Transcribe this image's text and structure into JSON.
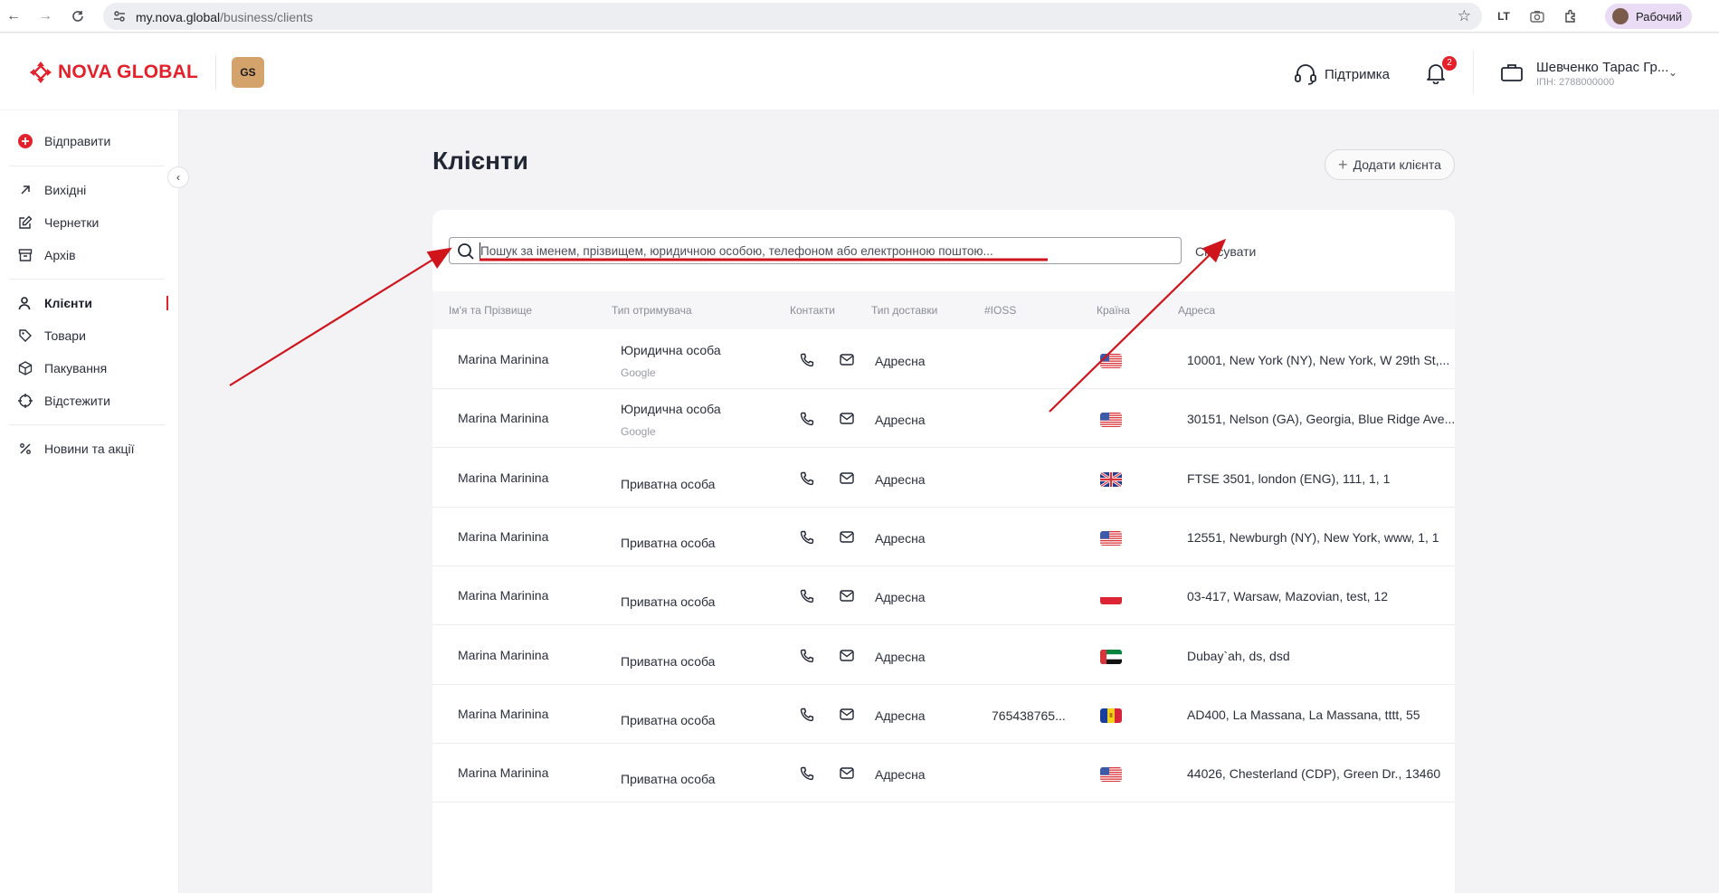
{
  "browser": {
    "url_host": "my.nova.global",
    "url_path": "/business/clients",
    "extension_label": "LT",
    "profile_name": "Рабочий"
  },
  "header": {
    "brand": "NOVA GLOBAL",
    "partner_badge": "GS",
    "support_label": "Підтримка",
    "notifications_count": "2",
    "user_name": "Шевченко Тарас Гр...",
    "user_ipn": "ІПН: 2788000000"
  },
  "sidebar": {
    "send_label": "Відправити",
    "items": [
      {
        "label": "Вихідні"
      },
      {
        "label": "Чернетки"
      },
      {
        "label": "Архів"
      },
      {
        "label": "Клієнти"
      },
      {
        "label": "Товари"
      },
      {
        "label": "Пакування"
      },
      {
        "label": "Відстежити"
      },
      {
        "label": "Новини та акції"
      }
    ]
  },
  "page": {
    "title": "Клієнти",
    "add_button": "Додати клієнта",
    "search_placeholder": "Пошук за іменем, прізвищем, юридичною особою, телефоном або електронною поштою...",
    "cancel_label": "Скасувати"
  },
  "table": {
    "columns": [
      "Ім'я та Прізвище",
      "Тип отримувача",
      "Контакти",
      "Тип доставки",
      "#IOSS",
      "Країна",
      "Адреса"
    ],
    "rows": [
      {
        "name": "Marina Marinina",
        "type": "Юридична особа",
        "sub": "Google",
        "delivery": "Адресна",
        "ioss": "",
        "flag": "us",
        "address": "10001, New York (NY), New York, W 29th St,..."
      },
      {
        "name": "Marina Marinina",
        "type": "Юридична особа",
        "sub": "Google",
        "delivery": "Адресна",
        "ioss": "",
        "flag": "us",
        "address": "30151, Nelson (GA), Georgia, Blue Ridge Ave..."
      },
      {
        "name": "Marina Marinina",
        "type": "Приватна особа",
        "sub": "",
        "delivery": "Адресна",
        "ioss": "",
        "flag": "gb",
        "address": "FTSE 3501, london (ENG), 111, 1, 1"
      },
      {
        "name": "Marina Marinina",
        "type": "Приватна особа",
        "sub": "",
        "delivery": "Адресна",
        "ioss": "",
        "flag": "us",
        "address": "12551, Newburgh (NY), New York, www, 1, 1"
      },
      {
        "name": "Marina Marinina",
        "type": "Приватна особа",
        "sub": "",
        "delivery": "Адресна",
        "ioss": "",
        "flag": "pl",
        "address": "03-417, Warsaw, Mazovian, test, 12"
      },
      {
        "name": "Marina Marinina",
        "type": "Приватна особа",
        "sub": "",
        "delivery": "Адресна",
        "ioss": "",
        "flag": "ae",
        "address": "Dubay`ah, ds, dsd"
      },
      {
        "name": "Marina Marinina",
        "type": "Приватна особа",
        "sub": "",
        "delivery": "Адресна",
        "ioss": "765438765...",
        "flag": "ad",
        "address": "AD400, La Massana, La Massana, tttt, 55"
      },
      {
        "name": "Marina Marinina",
        "type": "Приватна особа",
        "sub": "",
        "delivery": "Адресна",
        "ioss": "",
        "flag": "us",
        "address": "44026, Chesterland (CDP), Green Dr., 13460"
      }
    ]
  },
  "colors": {
    "brand_red": "#e4202a",
    "annotation_red": "#d0141c"
  }
}
